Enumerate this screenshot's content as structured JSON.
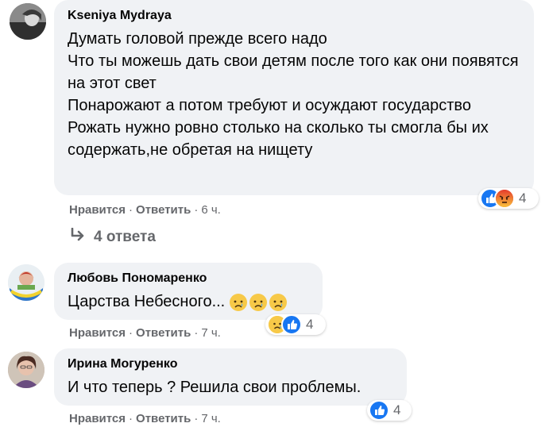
{
  "comments": [
    {
      "author": "Kseniya Mydraya",
      "text": "Думать головой прежде всего надо\nЧто ты можешь дать свои детям после того как они появятся на этот свет\nПонарожают а потом требуют и осуждают государство\nРожать нужно ровно столько на сколько ты смогла бы их содержать,не обретая на нищету",
      "like_label": "Нравится",
      "reply_label": "Ответить",
      "time": "6 ч.",
      "reaction_icons": [
        "like",
        "angry"
      ],
      "reaction_count": "4"
    },
    {
      "author": "Любовь Пономаренко",
      "text": "Царства Небесного...",
      "text_emoji": [
        "sad",
        "sad",
        "sad"
      ],
      "like_label": "Нравится",
      "reply_label": "Ответить",
      "time": "7 ч.",
      "reaction_icons": [
        "sad",
        "like"
      ],
      "reaction_count": "4"
    },
    {
      "author": "Ирина Могуренко",
      "text": "И что теперь ? Решила свои проблемы.",
      "like_label": "Нравится",
      "reply_label": "Ответить",
      "time": "7 ч.",
      "reaction_icons": [
        "like"
      ],
      "reaction_count": "4"
    }
  ],
  "replies_link": "4 ответа",
  "separator": "·",
  "colors": {
    "bubble": "#f0f2f5",
    "like_blue": "#1877f2",
    "muted": "#65676b"
  }
}
